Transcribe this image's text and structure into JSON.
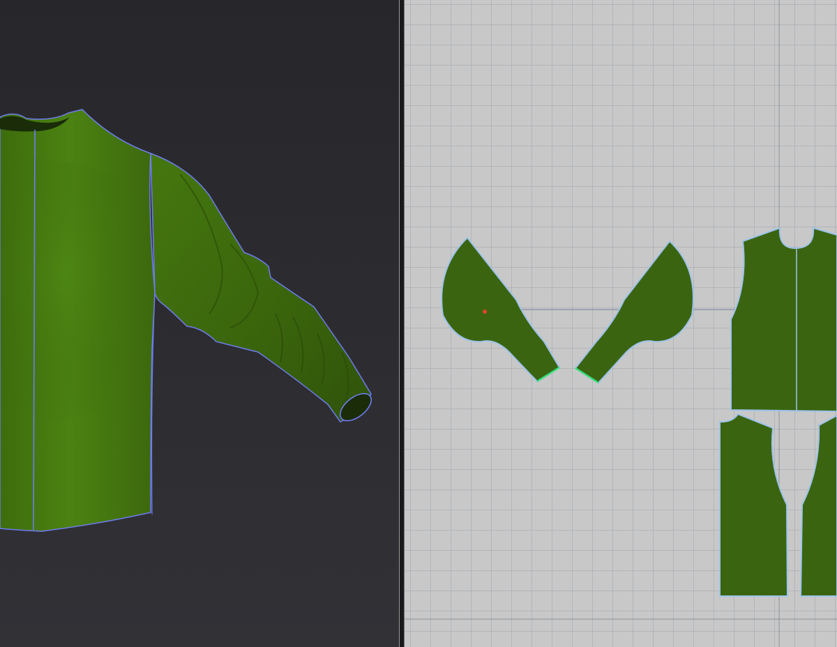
{
  "app": {
    "views": [
      "3d-garment-view",
      "2d-pattern-view"
    ]
  },
  "colors": {
    "viewport_3d_background": "#2b2b2f",
    "viewport_2d_background": "#c8c8c8",
    "grid_line": "#a6acb4",
    "fabric_green": "#3f6b0e",
    "fabric_green_light": "#4a8012",
    "pattern_fill": "#3b6410",
    "pattern_outline": "#9cc3ea",
    "seam_line_3d": "#6f7cf2",
    "selected_edge": "#32e07a",
    "pin_marker": "#e0442c",
    "axis_line": "#8a8f96"
  },
  "garment": {
    "type": "long-sleeve-shirt",
    "pieces": [
      "left-sleeve",
      "right-sleeve",
      "front-bodice",
      "back-panels"
    ]
  }
}
